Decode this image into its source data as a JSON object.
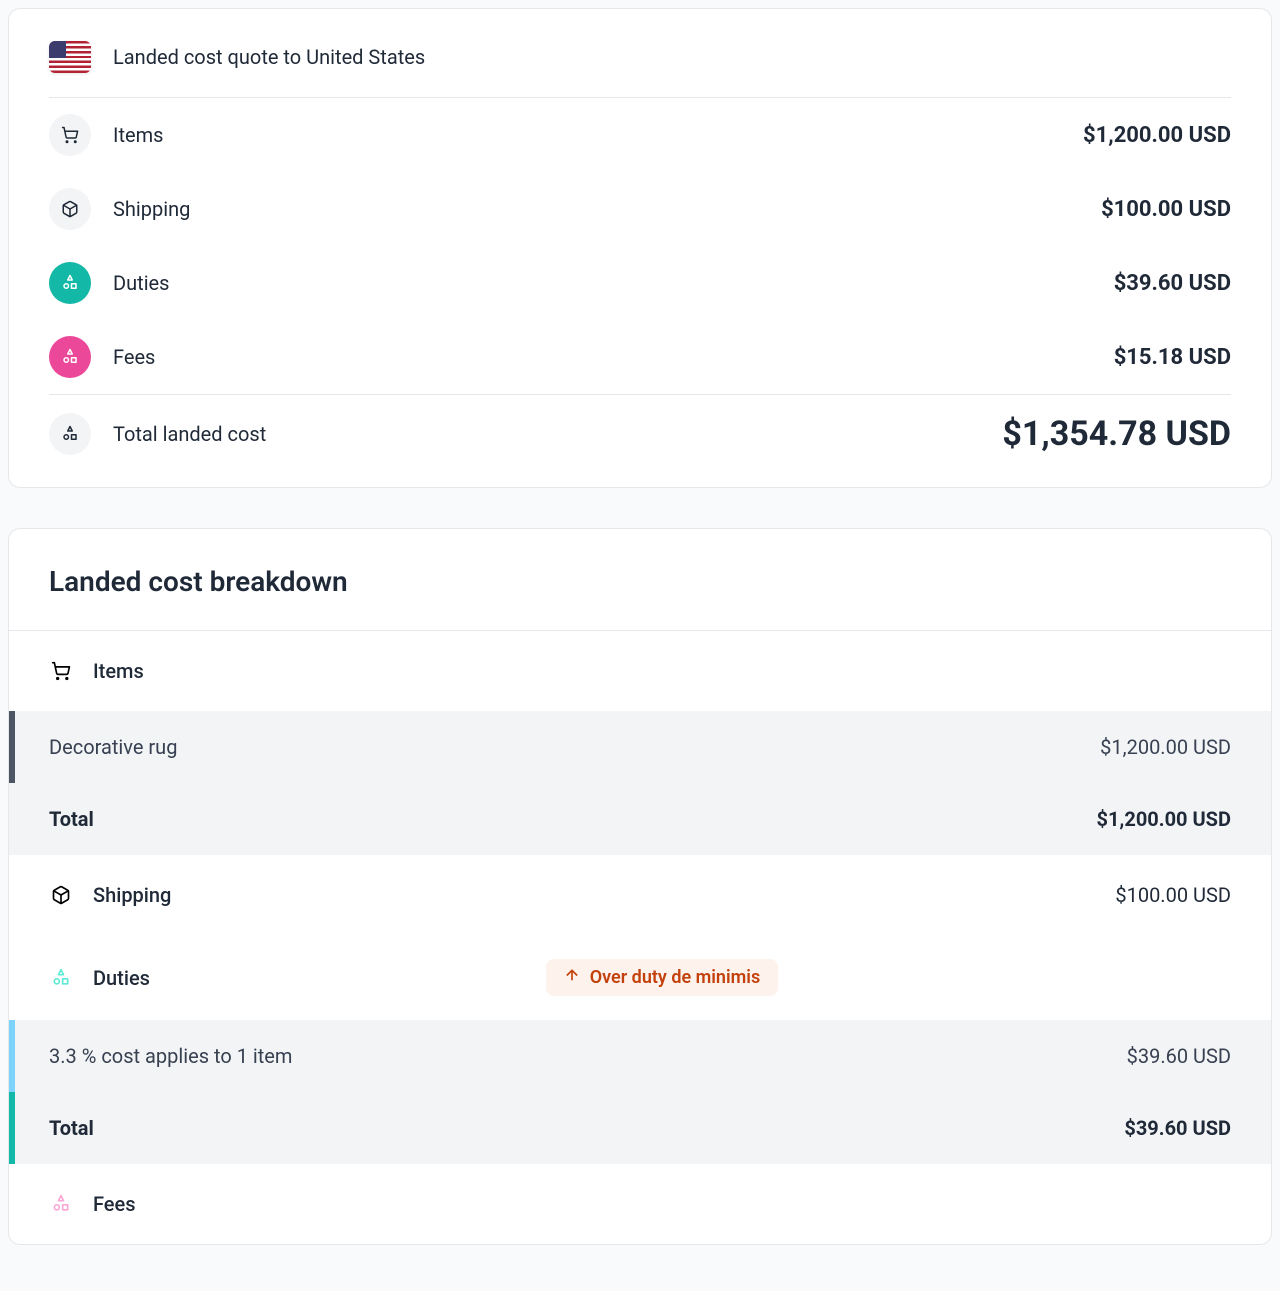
{
  "summary": {
    "title": "Landed cost quote to United States",
    "rows": [
      {
        "label": "Items",
        "value": "$1,200.00 USD"
      },
      {
        "label": "Shipping",
        "value": "$100.00 USD"
      },
      {
        "label": "Duties",
        "value": "$39.60 USD"
      },
      {
        "label": "Fees",
        "value": "$15.18 USD"
      }
    ],
    "total": {
      "label": "Total landed cost",
      "value": "$1,354.78 USD"
    }
  },
  "breakdown": {
    "title": "Landed cost breakdown",
    "items": {
      "label": "Items",
      "rows": [
        {
          "label": "Decorative rug",
          "value": "$1,200.00 USD"
        }
      ],
      "total": {
        "label": "Total",
        "value": "$1,200.00 USD"
      }
    },
    "shipping": {
      "label": "Shipping",
      "value": "$100.00 USD"
    },
    "duties": {
      "label": "Duties",
      "badge": "Over duty de minimis",
      "rows": [
        {
          "label": "3.3 % cost applies to 1 item",
          "value": "$39.60 USD"
        }
      ],
      "total": {
        "label": "Total",
        "value": "$39.60 USD"
      }
    },
    "fees": {
      "label": "Fees"
    }
  }
}
